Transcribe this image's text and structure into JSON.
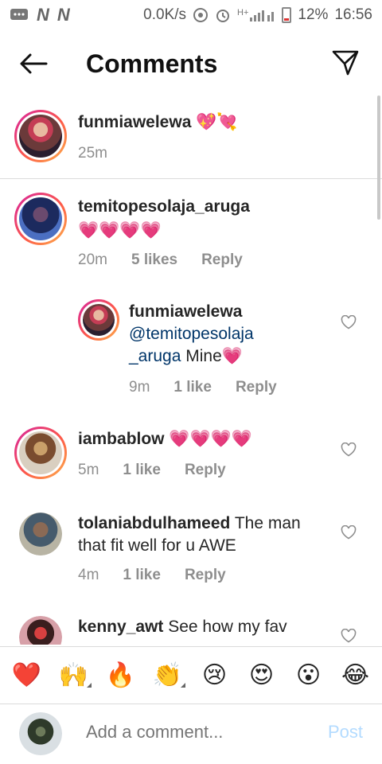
{
  "status": {
    "network_speed": "0.0K/s",
    "signal_label": "H+",
    "battery": "12%",
    "time": "16:56"
  },
  "header": {
    "title": "Comments"
  },
  "comments": [
    {
      "username": "funmiawelewa",
      "text": "💖💘",
      "time": "25m"
    },
    {
      "username": "temitopesolaja_aruga",
      "text": "💗💗💗💗",
      "time": "20m",
      "likes": "5 likes",
      "reply": "Reply"
    },
    {
      "username": "funmiawelewa",
      "mention_1": "@temitopesolaja",
      "mention_2": "_aruga",
      "text": " Mine💗",
      "time": "9m",
      "likes": "1 like",
      "reply": "Reply"
    },
    {
      "username": "iambablow",
      "text": "💗💗💗💗",
      "time": "5m",
      "likes": "1 like",
      "reply": "Reply"
    },
    {
      "username": "tolaniabdulhameed",
      "text_1": " The man",
      "text_2": "that fit well for u AWE",
      "time": "4m",
      "likes": "1 like",
      "reply": "Reply"
    },
    {
      "username": "kenny_awt",
      "text": " See how my fav"
    }
  ],
  "emojis": [
    "❤️",
    "🙌",
    "🔥",
    "👏",
    "😢",
    "😍",
    "😮",
    "😂"
  ],
  "composer": {
    "placeholder": "Add a comment...",
    "post": "Post"
  }
}
